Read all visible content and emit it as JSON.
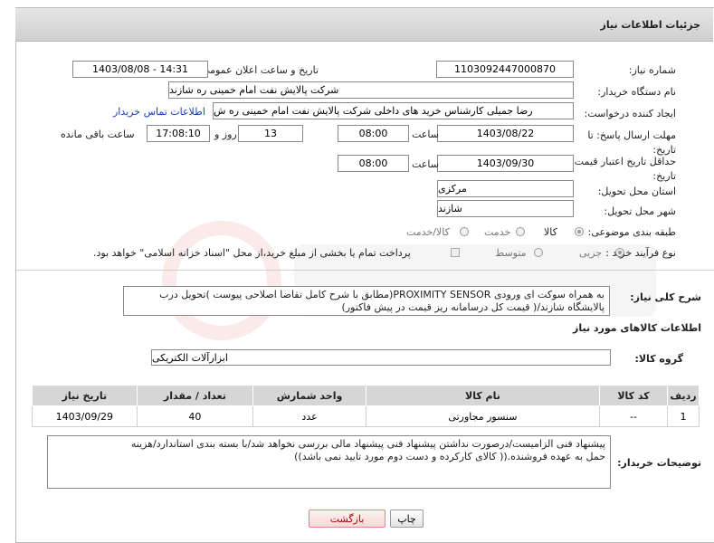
{
  "header": {
    "title": "جزئیات اطلاعات نیاز"
  },
  "fields": {
    "need_number": {
      "label": "شماره نیاز:",
      "value": "1103092447000870"
    },
    "announce_date": {
      "label": "تاریخ و ساعت اعلان عمومی:",
      "value": "1403/08/08 - 14:31"
    },
    "buyer_org": {
      "label": "نام دستگاه خریدار:",
      "value": "شرکت پالایش نفت امام خمینی  ره  شازند"
    },
    "requester": {
      "label": "ایجاد کننده درخواست:",
      "value": "رضا جمیلی کارشناس خرید های داخلی  شرکت پالایش نفت امام خمینی  ره  ش",
      "contact_link": "اطلاعات تماس خریدار"
    },
    "reply_deadline": {
      "label": "مهلت ارسال پاسخ: تا تاریخ:",
      "date": "1403/08/22",
      "time_label": "ساعت",
      "time": "08:00",
      "days": "13",
      "days_label": "روز و",
      "remaining": "17:08:10",
      "remaining_label": "ساعت باقی مانده"
    },
    "price_validity": {
      "label": "حداقل تاریخ اعتبار قیمت: تا تاریخ:",
      "date": "1403/09/30",
      "time_label": "ساعت",
      "time": "08:00"
    },
    "province": {
      "label": "استان محل تحویل:",
      "value": "مرکزی"
    },
    "city": {
      "label": "شهر محل تحویل:",
      "value": "شازند"
    },
    "category": {
      "label": "طبقه بندی موضوعی:",
      "options": [
        "کالا",
        "خدمت",
        "کالا/خدمت"
      ],
      "selected": "کالا"
    },
    "process_type": {
      "label": "نوع فرآیند خرید :",
      "options": [
        "جزیی",
        "متوسط"
      ],
      "selected": "جزیی",
      "payment_note": "پرداخت تمام یا بخشی از مبلغ خرید،از محل \"اسناد خزانه اسلامی\" خواهد بود."
    }
  },
  "description": {
    "label": "شرح کلی نیاز:",
    "line1": "به همراه سوکت ای ورودی PROXIMITY SENSOR(مطابق با شرح کامل تقاضا اصلاحی پیوست )تحویل درب",
    "line2": "پالایشگاه شازند/( قیمت کل درسامانه ریز قیمت در پیش فاکتور)"
  },
  "goods_info": {
    "section_title": "اطلاعات کالاهای مورد نیاز",
    "group_label": "گروه کالا:",
    "group_value": "ابزارآلات الکتریکی",
    "columns": [
      "ردیف",
      "کد کالا",
      "نام کالا",
      "واحد شمارش",
      "تعداد / مقدار",
      "تاریخ نیاز"
    ],
    "rows": [
      [
        "1",
        "--",
        "سنسور مجاورتی",
        "عدد",
        "40",
        "1403/09/29"
      ]
    ]
  },
  "buyer_notes": {
    "label": "توضیحات خریدار:",
    "line1": "پیشنهاد فنی الزامیست/درصورت نداشتن پیشنهاد فنی پیشنهاد مالی بررسی نخواهد شد/با بسته بندی استاندارد/هزینه",
    "line2": "حمل به عهده فروشنده.(( کالای کارکرده و دست دوم مورد تایید نمی باشد))"
  },
  "buttons": {
    "print": "چاپ",
    "back": "بازگشت"
  },
  "colors": {
    "header_bg": "#d9d9d9",
    "link": "#1a3fb0",
    "back_button": "#f8d8d8"
  }
}
